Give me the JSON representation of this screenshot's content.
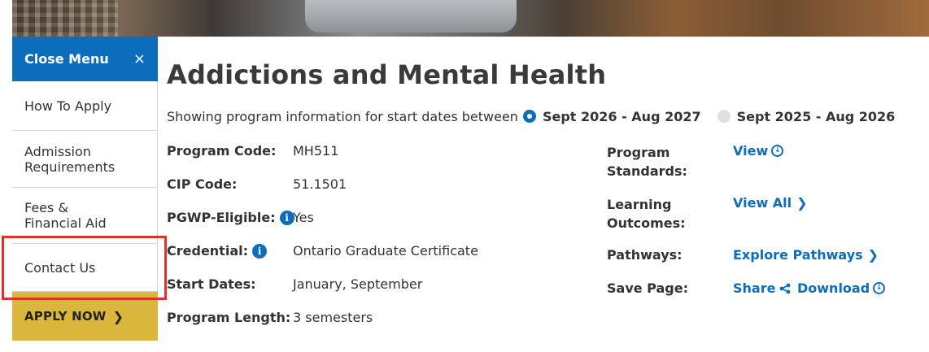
{
  "sidebar": {
    "close_label": "Close Menu",
    "close_icon": "×",
    "items": [
      {
        "label": "How To Apply"
      },
      {
        "label": "Admission Requirements"
      },
      {
        "label": "Fees & Financial Aid"
      },
      {
        "label": "Contact Us"
      }
    ],
    "apply_label": "APPLY NOW",
    "apply_icon": "❯"
  },
  "program": {
    "title": "Addictions and Mental Health",
    "dates_intro": "Showing program information for start dates between",
    "date_options": [
      {
        "label": "Sept 2026 - Aug 2027",
        "selected": true
      },
      {
        "label": "Sept 2025 - Aug 2026",
        "selected": false
      }
    ],
    "details": [
      {
        "label": "Program Code:",
        "value": "MH511"
      },
      {
        "label": "CIP Code:",
        "value": "51.1501"
      },
      {
        "label": "PGWP-Eligible:",
        "value": "Yes",
        "info": true
      },
      {
        "label": "Credential:",
        "value": "Ontario Graduate Certificate",
        "info": true
      },
      {
        "label": "Start Dates:",
        "value": "January, September"
      },
      {
        "label": "Program Length:",
        "value": "3 semesters"
      }
    ],
    "resources": {
      "standards_label_1": "Program",
      "standards_label_2": "Standards:",
      "standards_link": "View",
      "outcomes_label_1": "Learning",
      "outcomes_label_2": "Outcomes:",
      "outcomes_link": "View All",
      "pathways_label": "Pathways:",
      "pathways_link": "Explore Pathways",
      "save_label": "Save Page:",
      "share_link": "Share",
      "download_link": "Download"
    }
  },
  "info_glyph": "i",
  "colors": {
    "primary_blue": "#0d6dbd",
    "apply_gold": "#dbb63c",
    "highlight_red": "#d9342b"
  }
}
